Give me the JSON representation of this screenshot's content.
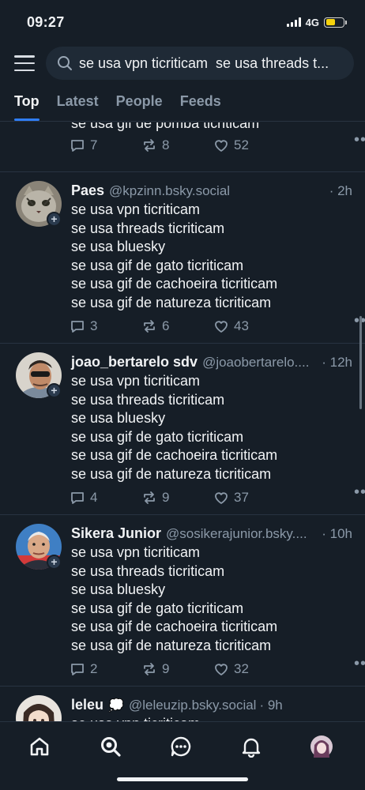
{
  "status_bar": {
    "time": "09:27",
    "network": "4G",
    "battery_level": 0.55,
    "battery_color": "#f5d20c"
  },
  "search": {
    "value": "se usa vpn ticriticam  se usa threads t..."
  },
  "tabs": [
    {
      "label": "Top",
      "active": true
    },
    {
      "label": "Latest",
      "active": false
    },
    {
      "label": "People",
      "active": false
    },
    {
      "label": "Feeds",
      "active": false
    }
  ],
  "posts": [
    {
      "text": "se usa gif de pomba ticriticam",
      "replies": "7",
      "reposts": "8",
      "likes": "52"
    },
    {
      "author": "Paes",
      "handle": "@kpzinn.bsky.social",
      "ago": "· 2h",
      "avatar_icon": "cat-avatar",
      "text": "se usa vpn ticriticam\nse usa threads ticriticam\nse usa bluesky\nse usa gif de gato ticriticam\nse usa gif de cachoeira ticriticam\nse usa gif de natureza ticriticam",
      "replies": "3",
      "reposts": "6",
      "likes": "43"
    },
    {
      "author": "joao_bertarelo sdv",
      "handle": "@joaobertarelo....",
      "ago": "· 12h",
      "avatar_icon": "man-sunglasses-avatar",
      "text": "se usa vpn ticriticam\nse usa threads ticriticam\nse usa bluesky\nse usa gif de gato ticriticam\nse usa gif de cachoeira ticriticam\nse usa gif de natureza ticriticam",
      "replies": "4",
      "reposts": "9",
      "likes": "37"
    },
    {
      "author": "Sikera Junior",
      "handle": "@sosikerajunior.bsky....",
      "ago": "· 10h",
      "avatar_icon": "man-suit-avatar",
      "text": "se usa vpn ticriticam\nse usa threads ticriticam\nse usa bluesky\nse usa gif de gato ticriticam\nse usa gif de cachoeira ticriticam\nse usa gif de natureza ticriticam",
      "replies": "2",
      "reposts": "9",
      "likes": "32"
    },
    {
      "author": "leleu",
      "emoji": "💭",
      "handle": "@leleuzip.bsky.social",
      "ago": "· 9h",
      "avatar_icon": "anime-girl-avatar",
      "text": "se usa vpn ticriticam"
    }
  ],
  "bottom_nav": [
    {
      "icon": "home-icon"
    },
    {
      "icon": "search-icon",
      "active": true
    },
    {
      "icon": "chat-icon"
    },
    {
      "icon": "bell-icon"
    },
    {
      "icon": "profile-avatar-icon"
    }
  ],
  "colors": {
    "background": "#161e27",
    "accent": "#2f7df6",
    "muted_text": "#8b99a8",
    "divider": "#283341"
  }
}
